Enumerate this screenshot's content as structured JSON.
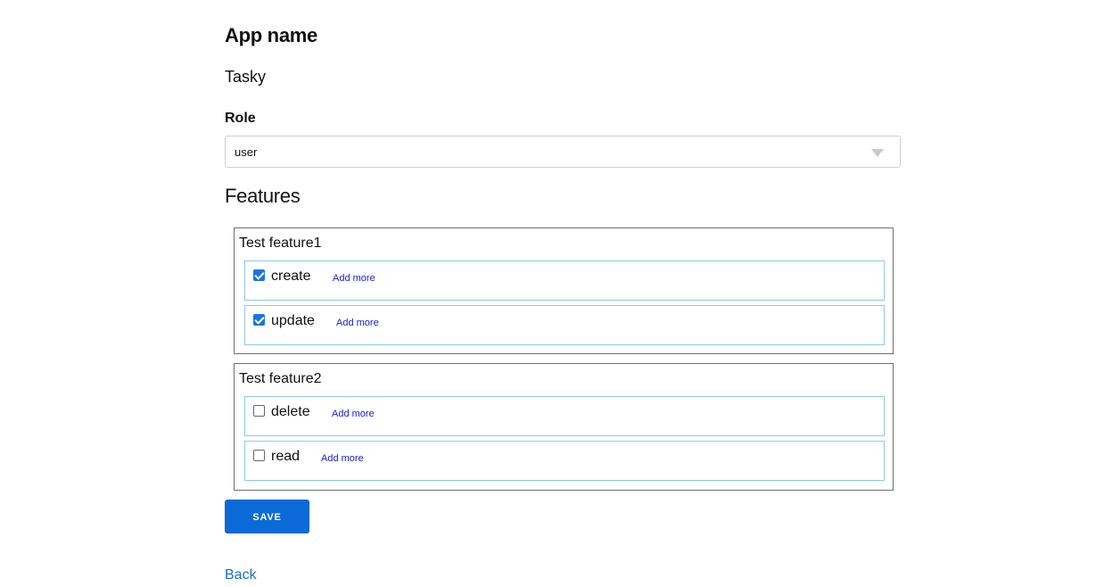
{
  "form": {
    "app_name_label": "App name",
    "app_name_value": "Tasky",
    "role_label": "Role",
    "role_selected": "user",
    "features_heading": "Features"
  },
  "features": [
    {
      "title": "Test feature1",
      "permissions": [
        {
          "name": "create",
          "checked": true,
          "add_more": "Add more"
        },
        {
          "name": "update",
          "checked": true,
          "add_more": "Add more"
        }
      ]
    },
    {
      "title": "Test feature2",
      "permissions": [
        {
          "name": "delete",
          "checked": false,
          "add_more": "Add more"
        },
        {
          "name": "read",
          "checked": false,
          "add_more": "Add more"
        }
      ]
    }
  ],
  "actions": {
    "save_label": "SAVE",
    "back_label": "Back"
  },
  "colors": {
    "primary": "#0b6ad7",
    "link": "#1a6fc9",
    "add_more_link": "#1a1adb",
    "row_border": "#8ecbe0"
  }
}
